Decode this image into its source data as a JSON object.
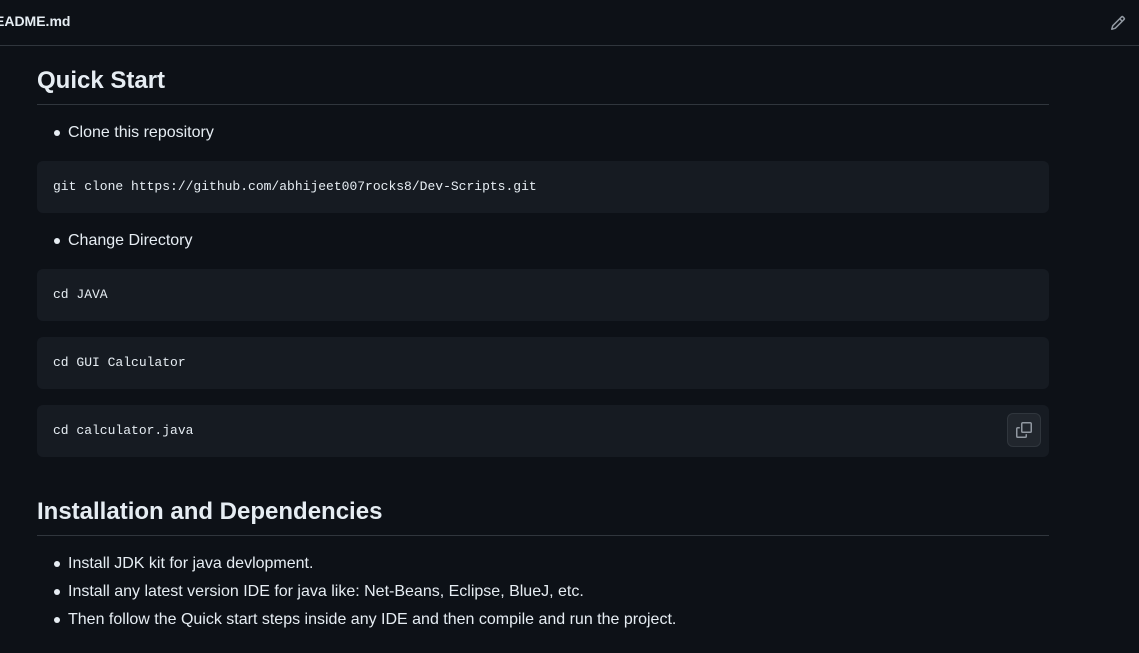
{
  "header": {
    "title": "EADME.md",
    "edit_icon": "pencil-icon"
  },
  "quick_start": {
    "heading": "Quick Start",
    "step1": "Clone this repository",
    "clone_cmd": "git clone https://github.com/abhijeet007rocks8/Dev-Scripts.git",
    "step2": "Change Directory",
    "cmd_java": "cd JAVA",
    "cmd_gui": "cd GUI Calculator",
    "cmd_calc": "cd calculator.java",
    "copy_icon": "copy-icon"
  },
  "install": {
    "heading": "Installation and Dependencies",
    "items": [
      "Install JDK kit for java devlopment.",
      "Install any latest version IDE for java like: Net-Beans, Eclipse, BlueJ, etc.",
      "Then follow the Quick start steps inside any IDE and then compile and run the project."
    ]
  },
  "colors": {
    "background": "#0d1117",
    "code_background": "#161b22",
    "border": "#30363d",
    "text": "#e6edf3"
  }
}
